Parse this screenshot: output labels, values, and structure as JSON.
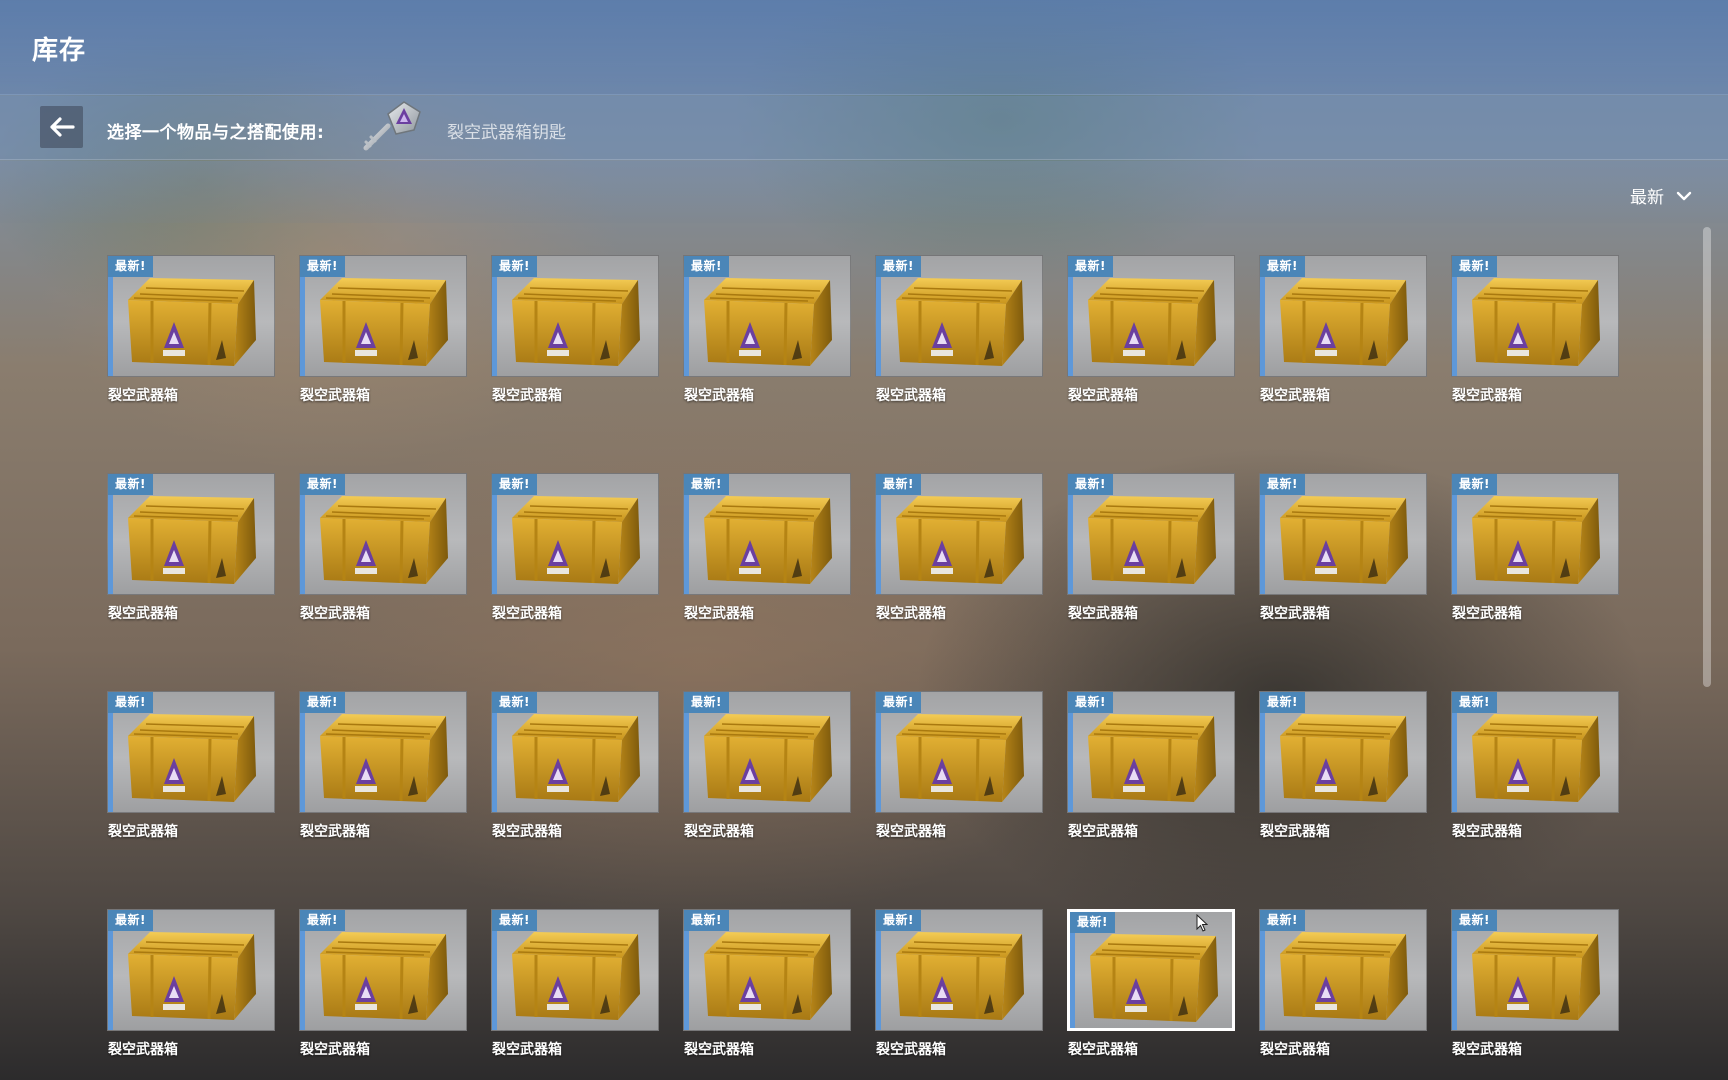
{
  "header": {
    "title": "库存"
  },
  "selection": {
    "prompt": "选择一个物品与之搭配使用:",
    "item_name": "裂空武器箱钥匙"
  },
  "sort": {
    "label": "最新"
  },
  "grid": {
    "columns": 8,
    "badge_label": "最新!",
    "selected_index": 29,
    "items": [
      {
        "name": "裂空武器箱"
      },
      {
        "name": "裂空武器箱"
      },
      {
        "name": "裂空武器箱"
      },
      {
        "name": "裂空武器箱"
      },
      {
        "name": "裂空武器箱"
      },
      {
        "name": "裂空武器箱"
      },
      {
        "name": "裂空武器箱"
      },
      {
        "name": "裂空武器箱"
      },
      {
        "name": "裂空武器箱"
      },
      {
        "name": "裂空武器箱"
      },
      {
        "name": "裂空武器箱"
      },
      {
        "name": "裂空武器箱"
      },
      {
        "name": "裂空武器箱"
      },
      {
        "name": "裂空武器箱"
      },
      {
        "name": "裂空武器箱"
      },
      {
        "name": "裂空武器箱"
      },
      {
        "name": "裂空武器箱"
      },
      {
        "name": "裂空武器箱"
      },
      {
        "name": "裂空武器箱"
      },
      {
        "name": "裂空武器箱"
      },
      {
        "name": "裂空武器箱"
      },
      {
        "name": "裂空武器箱"
      },
      {
        "name": "裂空武器箱"
      },
      {
        "name": "裂空武器箱"
      },
      {
        "name": "裂空武器箱"
      },
      {
        "name": "裂空武器箱"
      },
      {
        "name": "裂空武器箱"
      },
      {
        "name": "裂空武器箱"
      },
      {
        "name": "裂空武器箱"
      },
      {
        "name": "裂空武器箱"
      },
      {
        "name": "裂空武器箱"
      },
      {
        "name": "裂空武器箱"
      }
    ]
  },
  "colors": {
    "badge": "#4b86b8",
    "rarity": "#5e98d9",
    "case_gold": "#d6a326",
    "emblem_purple": "#6b3fa0"
  },
  "icons": {
    "back": "arrow-left-icon",
    "key": "key-icon",
    "sort": "chevron-down-icon",
    "case": "weapon-case-icon"
  }
}
